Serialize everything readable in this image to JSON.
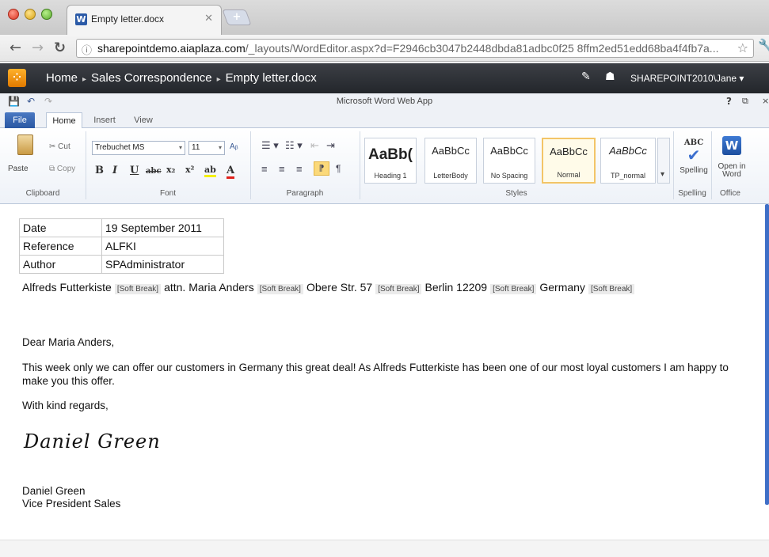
{
  "browser": {
    "tab_title": "Empty letter.docx",
    "tab_favicon": "W",
    "url_domain": "sharepointdemo.aiaplaza.com",
    "url_path": "/_layouts/WordEditor.aspx?d=F2946cb3047b2448dbda81adbc0f25 8ffm2ed51edd68ba4f4fb7a..."
  },
  "sharepoint": {
    "breadcrumb": [
      "Home",
      "Sales Correspondence",
      "Empty letter.docx"
    ],
    "user": "SHAREPOINT2010\\Jane ▾"
  },
  "word": {
    "app_title": "Microsoft Word Web App",
    "help": "?",
    "tabs": [
      "File",
      "Home",
      "Insert",
      "View"
    ],
    "clipboard": {
      "paste": "Paste",
      "cut": "Cut",
      "copy": "Copy",
      "label": "Clipboard"
    },
    "font": {
      "family": "Trebuchet MS",
      "size": "11",
      "label": "Font"
    },
    "paragraph": {
      "label": "Paragraph"
    },
    "styles": {
      "items": [
        {
          "sample": "AaBb(",
          "name": "Heading 1"
        },
        {
          "sample": "AaBbCc",
          "name": "LetterBody"
        },
        {
          "sample": "AaBbCc",
          "name": "No Spacing"
        },
        {
          "sample": "AaBbCc",
          "name": "Normal"
        },
        {
          "sample": "AaBbCc",
          "name": "TP_normal"
        }
      ],
      "label": "Styles"
    },
    "spelling": {
      "button": "Spelling",
      "label": "Spelling",
      "icon_text": "ABC"
    },
    "office": {
      "button_line1": "Open in",
      "button_line2": "Word",
      "label": "Office"
    }
  },
  "document": {
    "meta_rows": [
      {
        "key": "Date",
        "value": "19 September 2011"
      },
      {
        "key": "Reference",
        "value": "ALFKI"
      },
      {
        "key": "Author",
        "value": "SPAdministrator"
      }
    ],
    "address": {
      "name": "Alfreds Futterkiste",
      "attn": "attn. Maria Anders",
      "street": "Obere Str. 57",
      "city": "Berlin 12209",
      "country": "Germany",
      "soft_break": "[Soft Break]"
    },
    "greeting": "Dear Maria Anders,",
    "body": "This week only we can offer our customers in Germany this great deal! As Alfreds Futterkiste has been one of our most loyal customers I am happy to make you this offer.",
    "closing": "With kind regards,",
    "signature": "Daniel Green",
    "signer_name": "Daniel Green",
    "signer_title": "Vice President Sales"
  }
}
